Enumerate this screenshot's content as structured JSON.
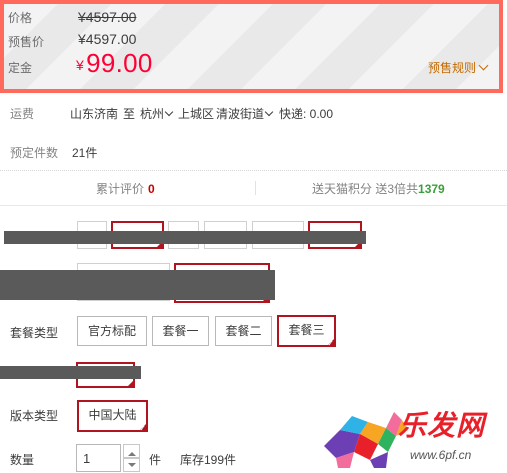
{
  "price": {
    "price_label": "价格",
    "price_value": "¥4597.00",
    "presale_label": "预售价",
    "presale_value": "¥4597.00",
    "deposit_label": "定金",
    "deposit_currency": "¥",
    "deposit_value": "99.00",
    "rules_link": "预售规则",
    "border_color": "#ff6a5c",
    "accent_color": "#ff0036"
  },
  "shipping": {
    "label": "运费",
    "from": "山东济南",
    "to_word": "至",
    "city": "杭州",
    "district": "上城区",
    "street": "清波街道",
    "fee": "快递: 0.00"
  },
  "preorder": {
    "label": "预定件数",
    "value": "21件"
  },
  "stats": {
    "reviews_label": "累计评价",
    "reviews_count": "0",
    "points_text": "送天猫积分 送3倍共",
    "points_value": "1379"
  },
  "sku": {
    "package_label": "套餐类型",
    "package_options": [
      "官方标配",
      "套餐一",
      "套餐二",
      "套餐三"
    ],
    "package_selected": "套餐三",
    "version_label": "版本类型",
    "version_options": [
      "中国大陆"
    ],
    "version_selected": "中国大陆",
    "selected_color": "#b0141e"
  },
  "quantity": {
    "label": "数量",
    "value": "1",
    "unit": "件",
    "stock": "库存199件"
  },
  "watermark": {
    "brand": "乐发网",
    "url": "www.6pf.cn"
  }
}
